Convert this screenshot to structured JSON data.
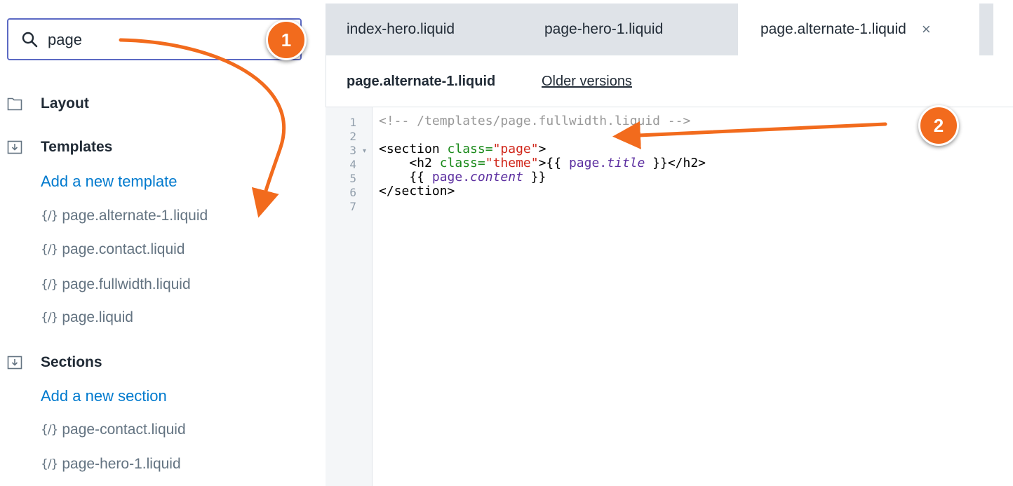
{
  "search": {
    "value": "page"
  },
  "sidebar": {
    "layout_label": "Layout",
    "templates_label": "Templates",
    "add_template": "Add a new template",
    "template_files": [
      "page.alternate-1.liquid",
      "page.contact.liquid",
      "page.fullwidth.liquid",
      "page.liquid"
    ],
    "sections_label": "Sections",
    "add_section": "Add a new section",
    "section_files": [
      "page-contact.liquid",
      "page-hero-1.liquid"
    ],
    "file_icon_glyph": "{/}"
  },
  "tabs": [
    {
      "label": "index-hero.liquid"
    },
    {
      "label": "page-hero-1.liquid"
    },
    {
      "label": "page.alternate-1.liquid",
      "active": true
    }
  ],
  "tab_close_glyph": "×",
  "editor": {
    "filename": "page.alternate-1.liquid",
    "older_versions": "Older versions",
    "line_numbers": [
      "1",
      "2",
      "3",
      "4",
      "5",
      "6",
      "7"
    ],
    "fold_glyph": "▾",
    "code": {
      "l1": "<!-- /templates/page.fullwidth.liquid -->",
      "l3a": "<section ",
      "l3b": "class=",
      "l3c": "\"page\"",
      "l3d": ">",
      "l4a": "    <h2 ",
      "l4b": "class=",
      "l4c": "\"theme\"",
      "l4d": ">{{ ",
      "l4e": "page.",
      "l4f": "title",
      "l4g": " }}</h2>",
      "l5a": "    {{ ",
      "l5b": "page.",
      "l5c": "content",
      "l5d": " }}",
      "l6": "</section>"
    }
  },
  "annotations": {
    "badge1": "1",
    "badge2": "2"
  },
  "colors": {
    "accent": "#f26b1d",
    "link": "#007ace",
    "focus": "#5c6ac4"
  }
}
